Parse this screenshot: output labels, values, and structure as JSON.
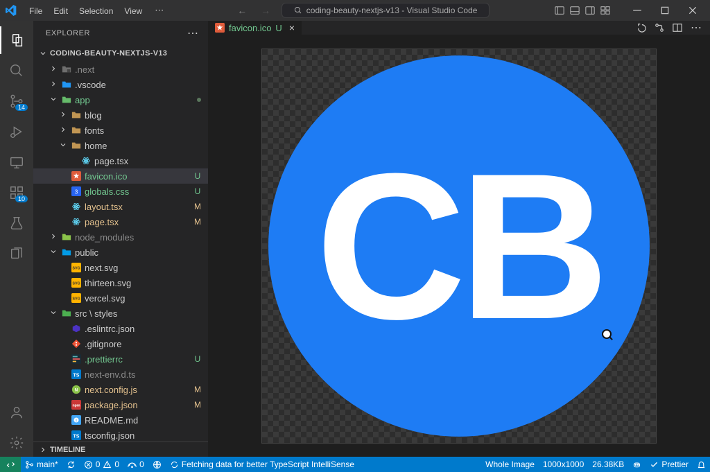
{
  "titlebar": {
    "menus": [
      "File",
      "Edit",
      "Selection",
      "View"
    ],
    "search_prefix": "coding-beauty-nextjs-v13 - Visual Studio Code"
  },
  "sidebar": {
    "header": "EXPLORER",
    "project": "CODING-BEAUTY-NEXTJS-V13",
    "timeline": "TIMELINE"
  },
  "activity": {
    "scm_badge": "14",
    "ext_badge": "10"
  },
  "tree": [
    {
      "depth": 1,
      "chev": "r",
      "icon": "folder-cube",
      "label": ".next",
      "cls": "dim"
    },
    {
      "depth": 1,
      "chev": "r",
      "icon": "folder-vscode",
      "label": ".vscode",
      "cls": ""
    },
    {
      "depth": 1,
      "chev": "d",
      "icon": "folder-app",
      "label": "app",
      "cls": "git-u",
      "dot": true
    },
    {
      "depth": 2,
      "chev": "r",
      "icon": "folder",
      "label": "blog",
      "cls": ""
    },
    {
      "depth": 2,
      "chev": "r",
      "icon": "folder",
      "label": "fonts",
      "cls": ""
    },
    {
      "depth": 2,
      "chev": "d",
      "icon": "folder",
      "label": "home",
      "cls": ""
    },
    {
      "depth": 3,
      "chev": "",
      "icon": "react",
      "label": "page.tsx",
      "cls": ""
    },
    {
      "depth": 2,
      "chev": "",
      "icon": "favicon",
      "label": "favicon.ico",
      "cls": "git-u selected",
      "status": "U"
    },
    {
      "depth": 2,
      "chev": "",
      "icon": "css",
      "label": "globals.css",
      "cls": "git-u",
      "status": "U"
    },
    {
      "depth": 2,
      "chev": "",
      "icon": "react",
      "label": "layout.tsx",
      "cls": "git-m",
      "status": "M"
    },
    {
      "depth": 2,
      "chev": "",
      "icon": "react",
      "label": "page.tsx",
      "cls": "git-m",
      "status": "M"
    },
    {
      "depth": 1,
      "chev": "r",
      "icon": "folder-node",
      "label": "node_modules",
      "cls": "dim"
    },
    {
      "depth": 1,
      "chev": "d",
      "icon": "folder-public",
      "label": "public",
      "cls": ""
    },
    {
      "depth": 2,
      "chev": "",
      "icon": "svg",
      "label": "next.svg",
      "cls": ""
    },
    {
      "depth": 2,
      "chev": "",
      "icon": "svg",
      "label": "thirteen.svg",
      "cls": ""
    },
    {
      "depth": 2,
      "chev": "",
      "icon": "svg",
      "label": "vercel.svg",
      "cls": ""
    },
    {
      "depth": 1,
      "chev": "d",
      "icon": "folder-src",
      "label": "src \\ styles",
      "cls": ""
    },
    {
      "depth": 2,
      "chev": "",
      "icon": "eslint",
      "label": ".eslintrc.json",
      "cls": ""
    },
    {
      "depth": 2,
      "chev": "",
      "icon": "git",
      "label": ".gitignore",
      "cls": ""
    },
    {
      "depth": 2,
      "chev": "",
      "icon": "prettier",
      "label": ".prettierrc",
      "cls": "git-u",
      "status": "U"
    },
    {
      "depth": 2,
      "chev": "",
      "icon": "ts",
      "label": "next-env.d.ts",
      "cls": "dim"
    },
    {
      "depth": 2,
      "chev": "",
      "icon": "js",
      "label": "next.config.js",
      "cls": "git-m",
      "status": "M"
    },
    {
      "depth": 2,
      "chev": "",
      "icon": "npm",
      "label": "package.json",
      "cls": "git-m",
      "status": "M"
    },
    {
      "depth": 2,
      "chev": "",
      "icon": "readme",
      "label": "README.md",
      "cls": ""
    },
    {
      "depth": 2,
      "chev": "",
      "icon": "tsconfig",
      "label": "tsconfig.json",
      "cls": ""
    }
  ],
  "tab": {
    "label": "favicon.ico",
    "status": "U"
  },
  "image_preview": {
    "text": "CB"
  },
  "statusbar": {
    "branch": "main*",
    "sync": "",
    "errors": "0",
    "warnings": "0",
    "ports": "0",
    "ts_status": "Fetching data for better TypeScript IntelliSense",
    "zoom": "Whole Image",
    "dims": "1000x1000",
    "size": "26.38KB",
    "prettier": "Prettier"
  }
}
